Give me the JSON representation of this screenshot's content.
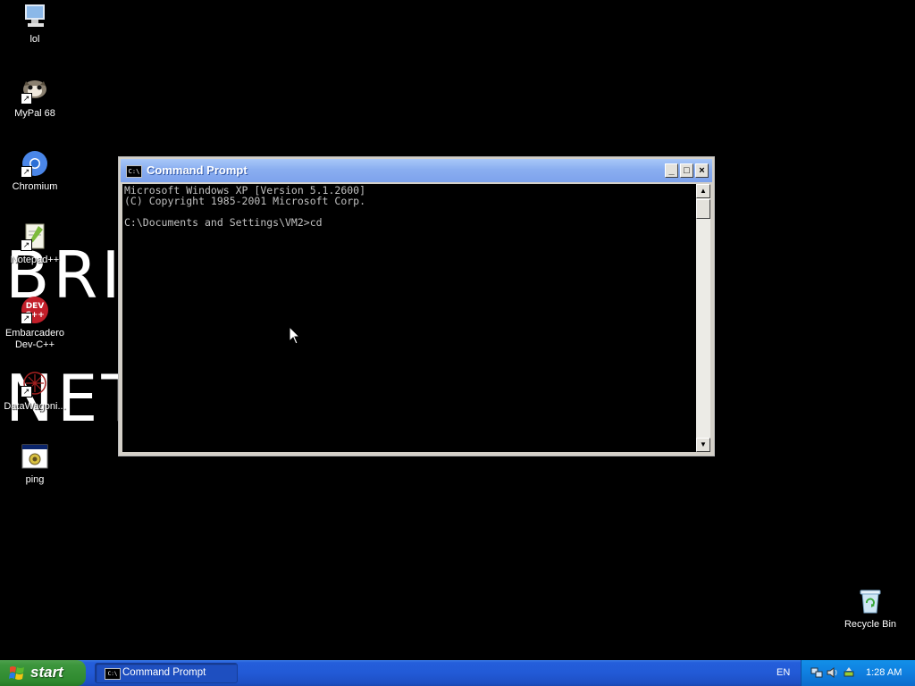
{
  "wallpaper": {
    "line1": "BRI",
    "line2": "NET"
  },
  "desktop_icons": [
    {
      "label": "lol"
    },
    {
      "label": "MyPal 68"
    },
    {
      "label": "Chromium"
    },
    {
      "label": "Notepad++"
    },
    {
      "label": "Embarcadero Dev-C++"
    },
    {
      "label": "DataWagoni..."
    },
    {
      "label": "ping"
    },
    {
      "label": "Recycle Bin"
    }
  ],
  "window": {
    "title": "Command Prompt",
    "icon_text": "C:\\",
    "lines": [
      "Microsoft Windows XP [Version 5.1.2600]",
      "(C) Copyright 1985-2001 Microsoft Corp.",
      "",
      "C:\\Documents and Settings\\VM2>cd"
    ]
  },
  "taskbar": {
    "start_label": "start",
    "task_label": "Command Prompt",
    "language": "EN",
    "clock": "1:28 AM"
  },
  "colors": {
    "taskbar": "#245edb",
    "start": "#3c963c",
    "tray": "#0f7fe0"
  }
}
